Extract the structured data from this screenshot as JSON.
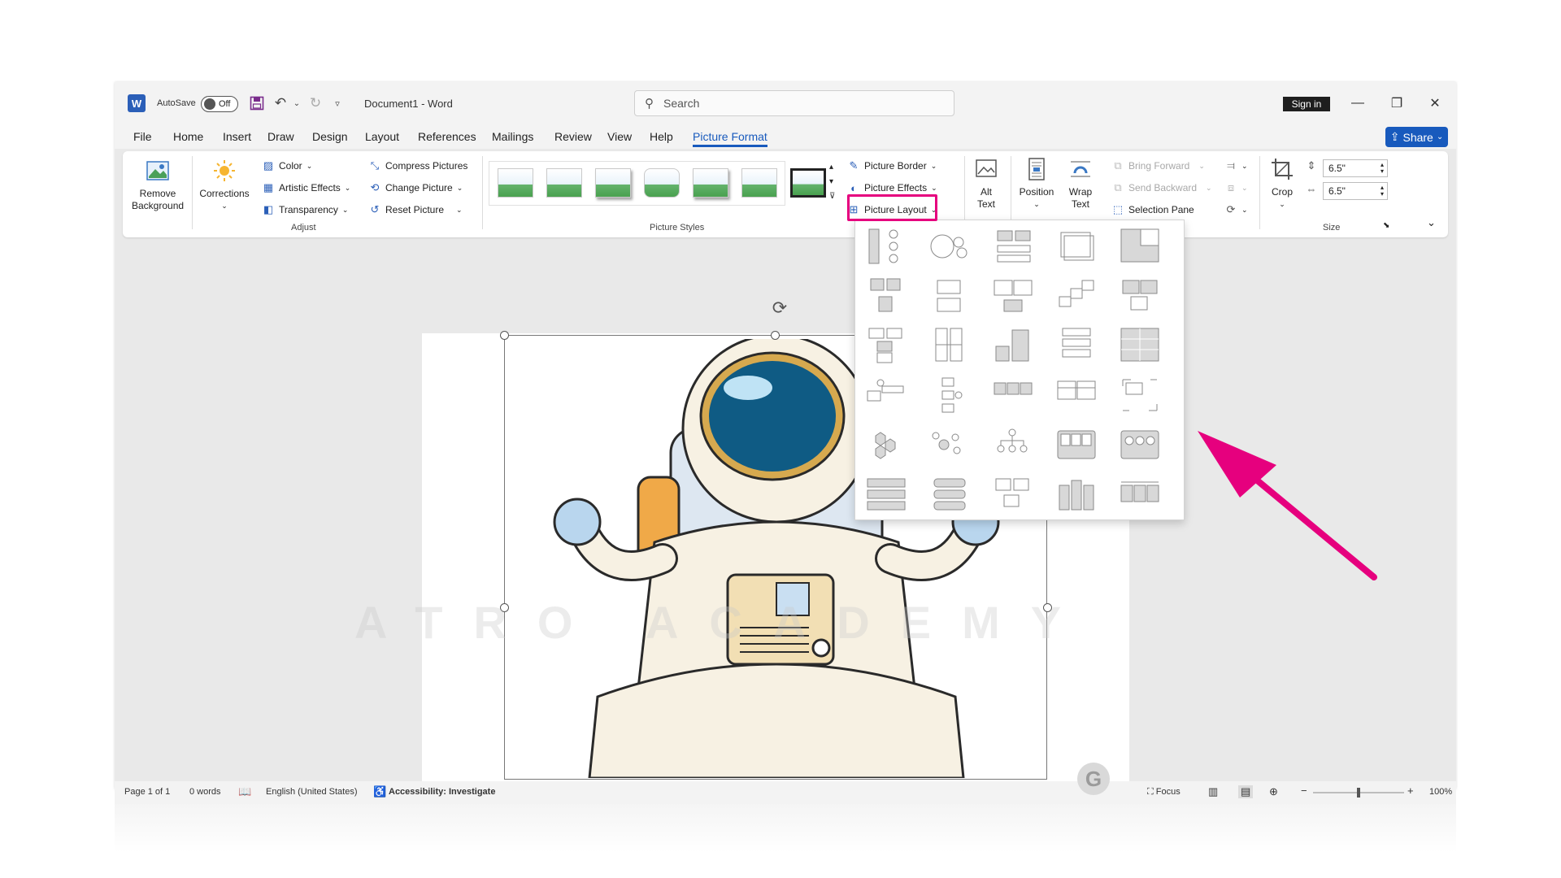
{
  "window": {
    "app_logo": "W",
    "autosave_label": "AutoSave",
    "autosave_state": "Off",
    "doc_title": "Document1  -  Word",
    "search_placeholder": "Search",
    "sign_in": "Sign in",
    "minimize_icon": "minimize-icon",
    "restore_icon": "restore-icon",
    "close_icon": "close-icon"
  },
  "tabs": [
    "File",
    "Home",
    "Insert",
    "Draw",
    "Design",
    "Layout",
    "References",
    "Mailings",
    "Review",
    "View",
    "Help",
    "Picture Format"
  ],
  "active_tab": "Picture Format",
  "share_label": "Share",
  "ribbon": {
    "remove_background": "Remove Background",
    "corrections": "Corrections",
    "color": "Color",
    "artistic_effects": "Artistic Effects",
    "transparency": "Transparency",
    "compress_pictures": "Compress Pictures",
    "change_picture": "Change Picture",
    "reset_picture": "Reset Picture",
    "adjust_group": "Adjust",
    "picture_styles_group": "Picture Styles",
    "picture_border": "Picture Border",
    "picture_effects": "Picture Effects",
    "picture_layout": "Picture Layout",
    "alt_text": "Alt Text",
    "position": "Position",
    "wrap_text": "Wrap Text",
    "bring_forward": "Bring Forward",
    "send_backward": "Send Backward",
    "selection_pane": "Selection Pane",
    "crop": "Crop",
    "height_value": "6.5\"",
    "width_value": "6.5\"",
    "size_group": "Size"
  },
  "statusbar": {
    "page": "Page 1 of 1",
    "words": "0 words",
    "language": "English (United States)",
    "accessibility": "Accessibility: Investigate",
    "focus": "Focus",
    "zoom": "100%",
    "zoom_level": 0.5
  },
  "watermark": "ATRO ACADEMY",
  "colors": {
    "accent": "#185abd",
    "highlight": "#e6007e",
    "arrow": "#e6007e"
  }
}
